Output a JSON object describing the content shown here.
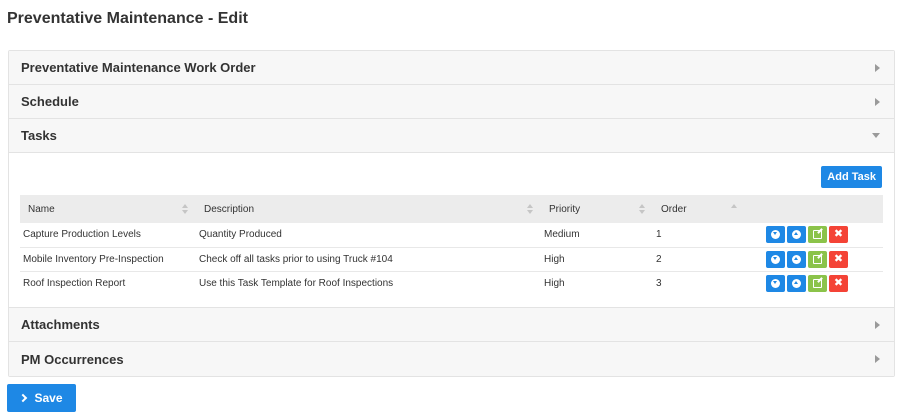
{
  "page": {
    "title": "Preventative Maintenance - Edit"
  },
  "panels": {
    "work_order": {
      "title": "Preventative Maintenance Work Order"
    },
    "schedule": {
      "title": "Schedule"
    },
    "tasks": {
      "title": "Tasks",
      "add_task_label": "Add Task"
    },
    "attachments": {
      "title": "Attachments"
    },
    "occurrences": {
      "title": "PM Occurrences"
    }
  },
  "tasks_table": {
    "columns": [
      "Name",
      "Description",
      "Priority",
      "Order"
    ],
    "rows": [
      {
        "name": "Capture Production Levels",
        "description": "Quantity Produced",
        "priority": "Medium",
        "order": "1"
      },
      {
        "name": "Mobile Inventory Pre-Inspection",
        "description": "Check off all tasks prior to using Truck #104",
        "priority": "High",
        "order": "2"
      },
      {
        "name": "Roof Inspection Report",
        "description": "Use this Task Template for Roof Inspections",
        "priority": "High",
        "order": "3"
      }
    ]
  },
  "actions": {
    "delete_glyph": "✖"
  },
  "footer": {
    "save_label": "Save"
  },
  "colors": {
    "primary": "#1e88e5",
    "success": "#8bc34a",
    "danger": "#f44336",
    "panel_header_bg": "#f7f7f7"
  }
}
